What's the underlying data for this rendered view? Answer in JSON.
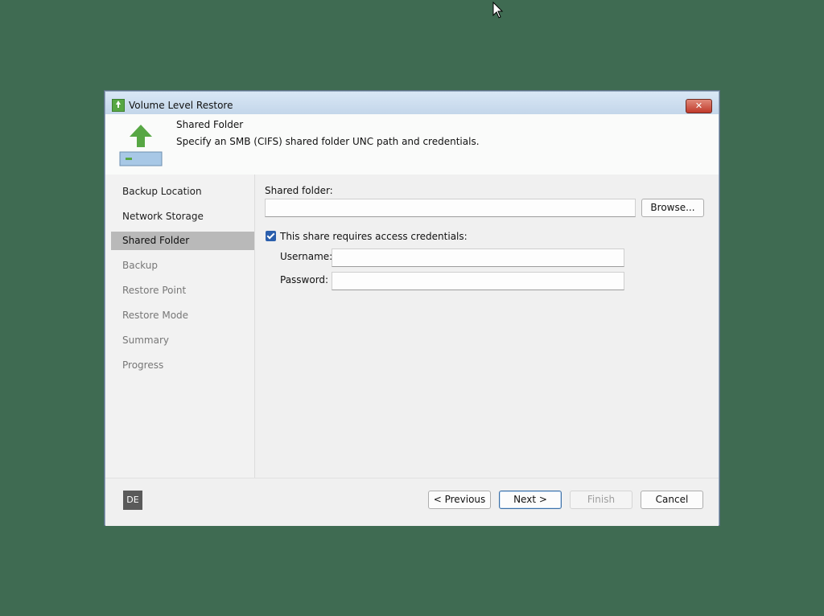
{
  "window": {
    "title": "Volume Level Restore",
    "close_label": "✕"
  },
  "header": {
    "title": "Shared Folder",
    "description": "Specify an SMB (CIFS) shared folder UNC path and credentials."
  },
  "steps": [
    {
      "label": "Backup Location",
      "state": "enabled"
    },
    {
      "label": "Network Storage",
      "state": "enabled"
    },
    {
      "label": "Shared Folder",
      "state": "active"
    },
    {
      "label": "Backup",
      "state": "disabled"
    },
    {
      "label": "Restore Point",
      "state": "disabled"
    },
    {
      "label": "Restore Mode",
      "state": "disabled"
    },
    {
      "label": "Summary",
      "state": "disabled"
    },
    {
      "label": "Progress",
      "state": "disabled"
    }
  ],
  "form": {
    "shared_folder_label": "Shared folder:",
    "shared_folder_value": "",
    "browse_label": "Browse...",
    "credentials_checkbox_label": "This share requires access credentials:",
    "credentials_checked": true,
    "username_label": "Username:",
    "username_value": "",
    "password_label": "Password:",
    "password_value": ""
  },
  "footer": {
    "language_badge": "DE",
    "previous_label": "< Previous",
    "next_label": "Next >",
    "finish_label": "Finish",
    "cancel_label": "Cancel"
  },
  "colors": {
    "desktop": "#3f6b52",
    "accent": "#2b5fad",
    "brand_green": "#57a744"
  }
}
